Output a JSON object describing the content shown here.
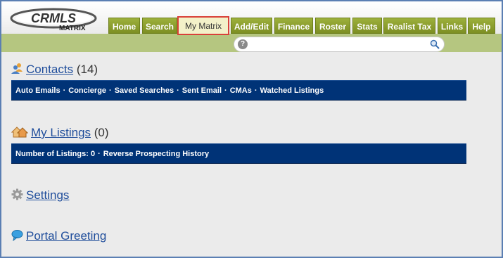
{
  "logo": {
    "brand": "CRMLS",
    "product": "MATRIX"
  },
  "nav": {
    "tabs": [
      {
        "label": "Home"
      },
      {
        "label": "Search"
      },
      {
        "label": "My Matrix"
      },
      {
        "label": "Add/Edit"
      },
      {
        "label": "Finance"
      },
      {
        "label": "Roster"
      },
      {
        "label": "Stats"
      },
      {
        "label": "Realist Tax"
      },
      {
        "label": "Links"
      },
      {
        "label": "Help"
      }
    ],
    "active_tab": "My Matrix"
  },
  "search": {
    "value": "",
    "placeholder": "",
    "help_glyph": "?"
  },
  "sections": {
    "contacts": {
      "title": "Contacts",
      "count": "(14)",
      "icon": "contacts-icon",
      "links": [
        "Auto Emails",
        "Concierge",
        "Saved Searches",
        "Sent Email",
        "CMAs",
        "Watched Listings"
      ]
    },
    "my_listings": {
      "title": "My Listings",
      "count": "(0)",
      "icon": "house-icon",
      "links": [
        "Number of Listings: 0",
        "Reverse Prospecting History"
      ]
    },
    "settings": {
      "title": "Settings",
      "icon": "gear-icon"
    },
    "portal_greeting": {
      "title": "Portal Greeting",
      "icon": "speech-bubble-icon"
    }
  },
  "colors": {
    "nav_green": "#8fa22d",
    "nav_bg": "#b5c680",
    "active_tab_bg": "#f3f1c9",
    "active_tab_border": "#d9413a",
    "section_bar": "#003377",
    "link": "#1f4d9b",
    "frame_border": "#5b7fb3"
  },
  "separator": "·"
}
